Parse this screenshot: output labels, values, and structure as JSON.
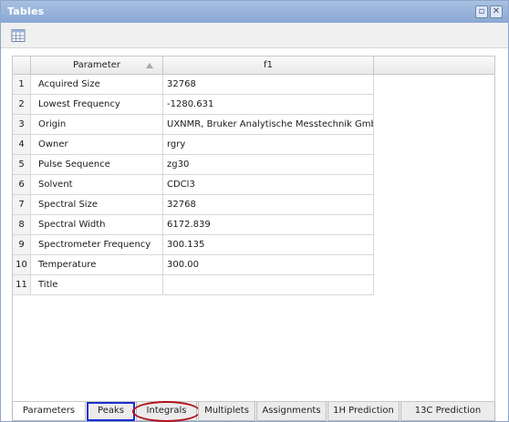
{
  "window": {
    "title": "Tables"
  },
  "table": {
    "headers": [
      "Parameter",
      "f1"
    ],
    "rows": [
      {
        "num": "1",
        "parameter": "Acquired Size",
        "value": "32768"
      },
      {
        "num": "2",
        "parameter": "Lowest Frequency",
        "value": "-1280.631"
      },
      {
        "num": "3",
        "parameter": "Origin",
        "value": "UXNMR, Bruker Analytische Messtechnik GmbH"
      },
      {
        "num": "4",
        "parameter": "Owner",
        "value": "rgry"
      },
      {
        "num": "5",
        "parameter": "Pulse Sequence",
        "value": "zg30"
      },
      {
        "num": "6",
        "parameter": "Solvent",
        "value": "CDCl3"
      },
      {
        "num": "7",
        "parameter": "Spectral Size",
        "value": "32768"
      },
      {
        "num": "8",
        "parameter": "Spectral Width",
        "value": "6172.839"
      },
      {
        "num": "9",
        "parameter": "Spectrometer Frequency",
        "value": "300.135"
      },
      {
        "num": "10",
        "parameter": "Temperature",
        "value": "300.00"
      },
      {
        "num": "11",
        "parameter": "Title",
        "value": ""
      }
    ]
  },
  "tabs": [
    {
      "label": "Parameters",
      "active": true
    },
    {
      "label": "Peaks",
      "highlight": "rect"
    },
    {
      "label": "Integrals",
      "highlight": "oval"
    },
    {
      "label": "Multiplets"
    },
    {
      "label": "Assignments"
    },
    {
      "label": "1H Prediction"
    },
    {
      "label": "13C Prediction"
    }
  ],
  "colors": {
    "titlebar": "#8aa8d4",
    "rect_highlight": "#1a2fcf",
    "oval_highlight": "#b0101a"
  }
}
